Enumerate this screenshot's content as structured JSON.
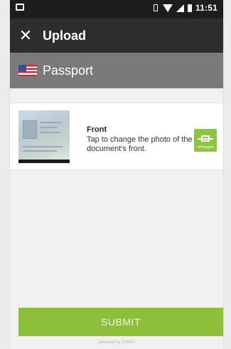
{
  "status_bar": {
    "time": "11:51"
  },
  "toolbar": {
    "close_icon": "close-icon",
    "title": "Upload"
  },
  "document": {
    "flag_icon": "us-flag-icon",
    "title": "Passport"
  },
  "card": {
    "label": "Front",
    "description": "Tap to change the photo of the document's front.",
    "epassport_label": "ePassport"
  },
  "submit": {
    "label": "SUBMIT"
  },
  "footer": {
    "powered_by": "powered by JUMIO"
  },
  "colors": {
    "accent": "#8dbf3c",
    "toolbar": "#2d2d2d",
    "header": "#7a7a7a"
  }
}
